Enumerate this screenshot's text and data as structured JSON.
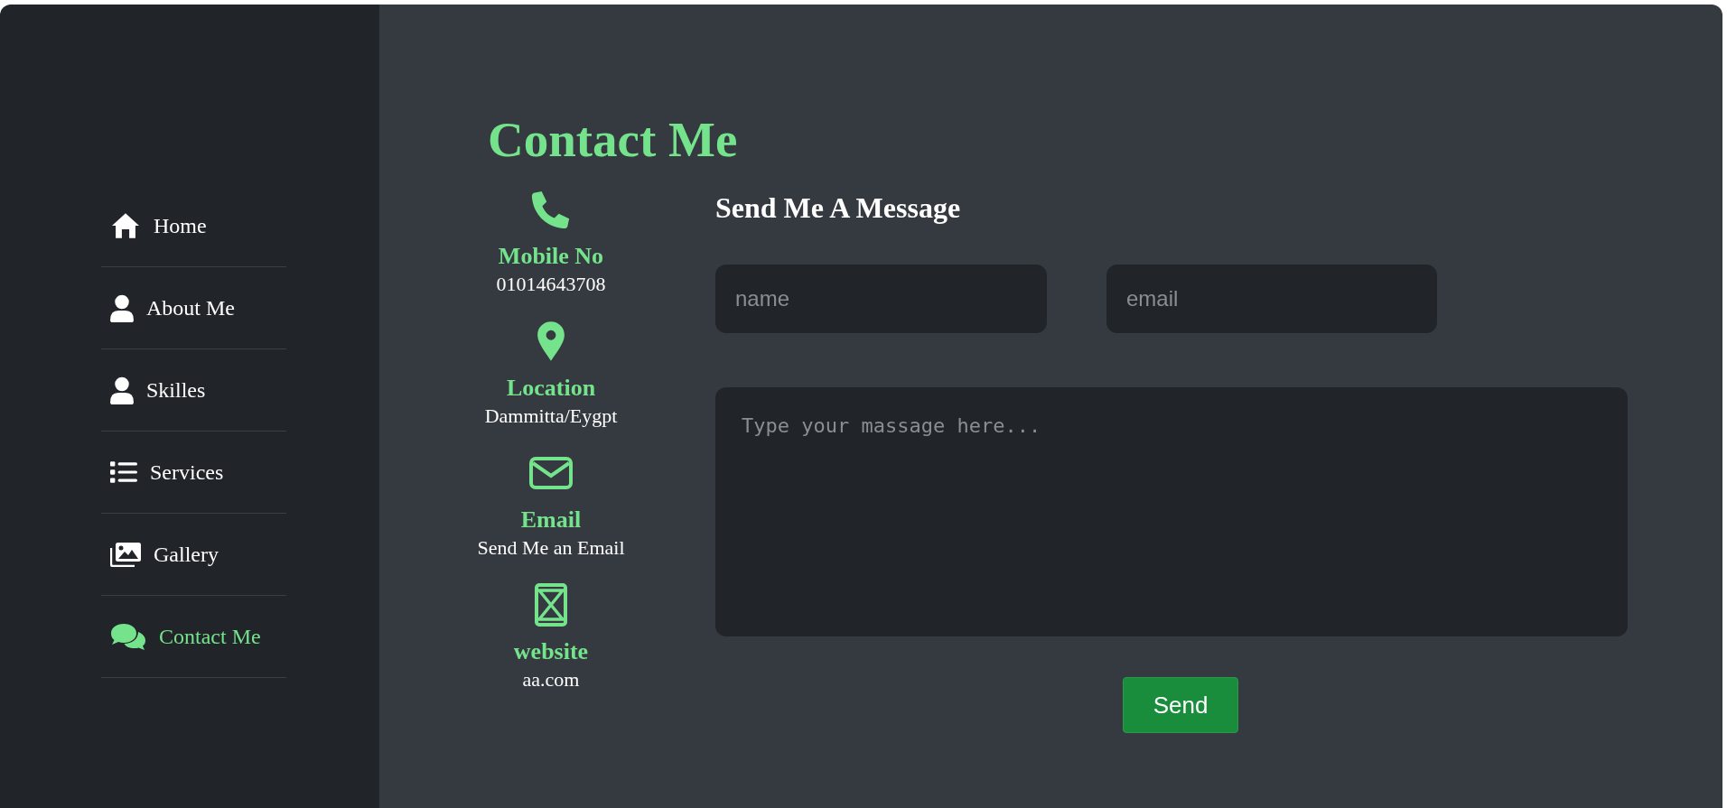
{
  "sidebar": {
    "items": [
      {
        "kind": "home",
        "label": "Home",
        "selected": false
      },
      {
        "kind": "person",
        "label": "About Me",
        "selected": false
      },
      {
        "kind": "person",
        "label": "Skilles",
        "selected": false
      },
      {
        "kind": "list",
        "label": "Services",
        "selected": false
      },
      {
        "kind": "images",
        "label": "Gallery",
        "selected": false
      },
      {
        "kind": "chat",
        "label": "Contact Me",
        "selected": true
      }
    ]
  },
  "page_title": "Contact Me",
  "contact_info": [
    {
      "kind": "phone",
      "label": "Mobile No",
      "value": "01014643708"
    },
    {
      "kind": "pin",
      "label": "Location",
      "value": "Dammitta/Eygpt"
    },
    {
      "kind": "mail",
      "label": "Email",
      "value": "Send Me an Email"
    },
    {
      "kind": "frame",
      "label": "website",
      "value": "aa.com"
    }
  ],
  "form": {
    "heading": "Send Me A Message",
    "name_placeholder": "name",
    "email_placeholder": "email",
    "message_placeholder": "Type your massage here...",
    "submit": "Send"
  }
}
